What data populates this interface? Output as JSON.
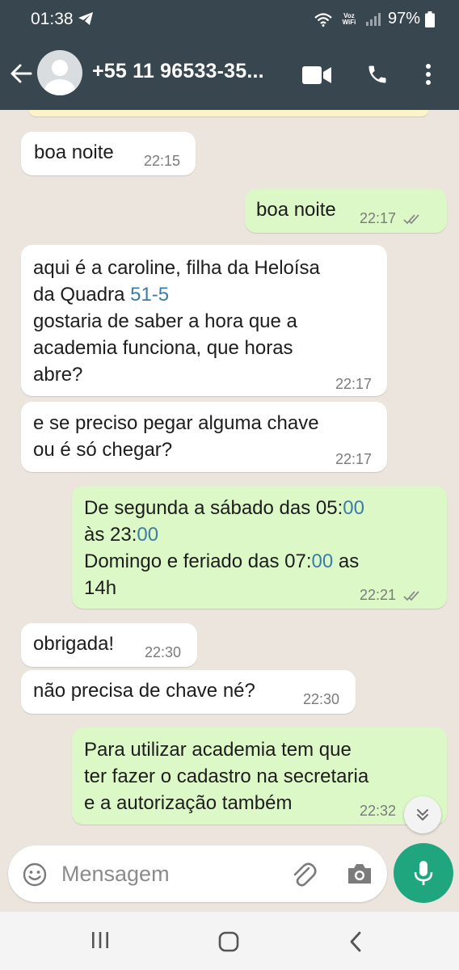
{
  "status_bar": {
    "time": "01:38",
    "network_label": "Voz WiFi",
    "battery": "97%"
  },
  "header": {
    "contact": "+55 11 96533-35..."
  },
  "messages": [
    {
      "dir": "in",
      "text": "boa noite",
      "time": "22:15"
    },
    {
      "dir": "out",
      "text": "boa noite",
      "time": "22:17"
    },
    {
      "dir": "in",
      "lines": [
        "aqui é a caroline, filha da Heloísa",
        "da Quadra ",
        "51-5",
        "gostaria de saber a hora que a",
        "academia funciona, que horas",
        "abre?"
      ],
      "time": "22:17"
    },
    {
      "dir": "in",
      "lines": [
        "e se preciso pegar alguma chave",
        "ou é só chegar?"
      ],
      "time": "22:17"
    },
    {
      "dir": "out",
      "lines": [
        "De segunda a sábado das 05:",
        "00",
        "às 23:",
        "00",
        "Domingo e feriado das 07:",
        "00",
        " as",
        "14h"
      ],
      "time": "22:21"
    },
    {
      "dir": "in",
      "text": "obrigada!",
      "time": "22:30"
    },
    {
      "dir": "in",
      "text": "não precisa de chave né?",
      "time": "22:30"
    },
    {
      "dir": "out",
      "lines": [
        "Para utilizar academia tem que",
        "ter fazer o cadastro na secretaria",
        "e a autorização também"
      ],
      "time": "22:32"
    }
  ],
  "input": {
    "placeholder": "Mensagem"
  },
  "colors": {
    "header_bg": "#37464f",
    "chat_bg": "#ece5dd",
    "outgoing_bubble": "#dcf8c6",
    "incoming_bubble": "#ffffff",
    "accent_green": "#1fa67e",
    "link_blue": "#3b7da6"
  },
  "icons": [
    "back-arrow-icon",
    "avatar-icon",
    "video-call-icon",
    "phone-icon",
    "more-vert-icon",
    "emoji-icon",
    "attach-icon",
    "camera-icon",
    "mic-icon",
    "double-check-icon",
    "scroll-down-icon",
    "recents-icon",
    "home-icon",
    "back-nav-icon"
  ]
}
